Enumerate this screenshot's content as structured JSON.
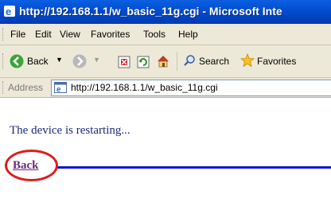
{
  "window": {
    "title": "http://192.168.1.1/w_basic_11g.cgi - Microsoft Inte"
  },
  "menu": {
    "items": [
      "File",
      "Edit",
      "View",
      "Favorites",
      "Tools",
      "Help"
    ]
  },
  "toolbar": {
    "back_label": "Back",
    "search_label": "Search",
    "favorites_label": "Favorites"
  },
  "address": {
    "label": "Address",
    "url": "http://192.168.1.1/w_basic_11g.cgi"
  },
  "page": {
    "message": "The device is restarting...",
    "back_link": "Back"
  },
  "colors": {
    "titlebar": "#0047c9",
    "link_visited": "#6b2a7a",
    "message_text": "#1a2a7a",
    "rule_line": "#1212d4",
    "annotation": "#dd1c1c"
  }
}
